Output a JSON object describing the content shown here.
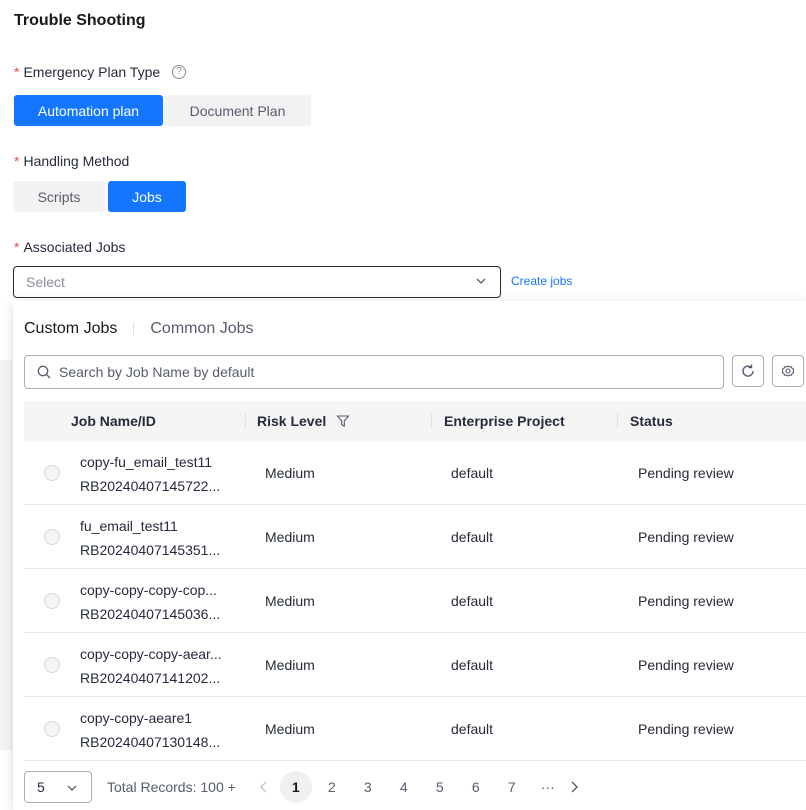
{
  "page": {
    "title": "Trouble Shooting"
  },
  "emergency_plan": {
    "label": "Emergency Plan Type",
    "required_mark": "*",
    "help_icon": "?",
    "options": [
      "Automation plan",
      "Document Plan"
    ],
    "selected": "Automation plan"
  },
  "handling_method": {
    "label": "Handling Method",
    "required_mark": "*",
    "options": [
      "Scripts",
      "Jobs"
    ],
    "selected": "Jobs"
  },
  "associated_jobs": {
    "label": "Associated Jobs",
    "required_mark": "*",
    "placeholder": "Select",
    "create_link": "Create jobs"
  },
  "dropdown": {
    "tabs": [
      "Custom Jobs",
      "Common Jobs"
    ],
    "active_tab": "Custom Jobs",
    "search_placeholder": "Search by Job Name by default",
    "columns": [
      "Job Name/ID",
      "Risk Level",
      "Enterprise Project",
      "Status"
    ],
    "rows": [
      {
        "name": "copy-fu_email_test11",
        "id": "RB20240407145722...",
        "risk": "Medium",
        "project": "default",
        "status": "Pending review"
      },
      {
        "name": "fu_email_test11",
        "id": "RB20240407145351...",
        "risk": "Medium",
        "project": "default",
        "status": "Pending review"
      },
      {
        "name": "copy-copy-copy-cop...",
        "id": "RB20240407145036...",
        "risk": "Medium",
        "project": "default",
        "status": "Pending review"
      },
      {
        "name": "copy-copy-copy-aear...",
        "id": "RB20240407141202...",
        "risk": "Medium",
        "project": "default",
        "status": "Pending review"
      },
      {
        "name": "copy-copy-aeare1",
        "id": "RB20240407130148...",
        "risk": "Medium",
        "project": "default",
        "status": "Pending review"
      }
    ],
    "pagination": {
      "page_size": "5",
      "total": "Total Records: 100 +",
      "pages": [
        "1",
        "2",
        "3",
        "4",
        "5",
        "6",
        "7"
      ],
      "current": "1",
      "ellipsis": "···"
    }
  },
  "colors": {
    "primary": "#1476ff",
    "required": "#e84e40",
    "text": "#191919"
  }
}
